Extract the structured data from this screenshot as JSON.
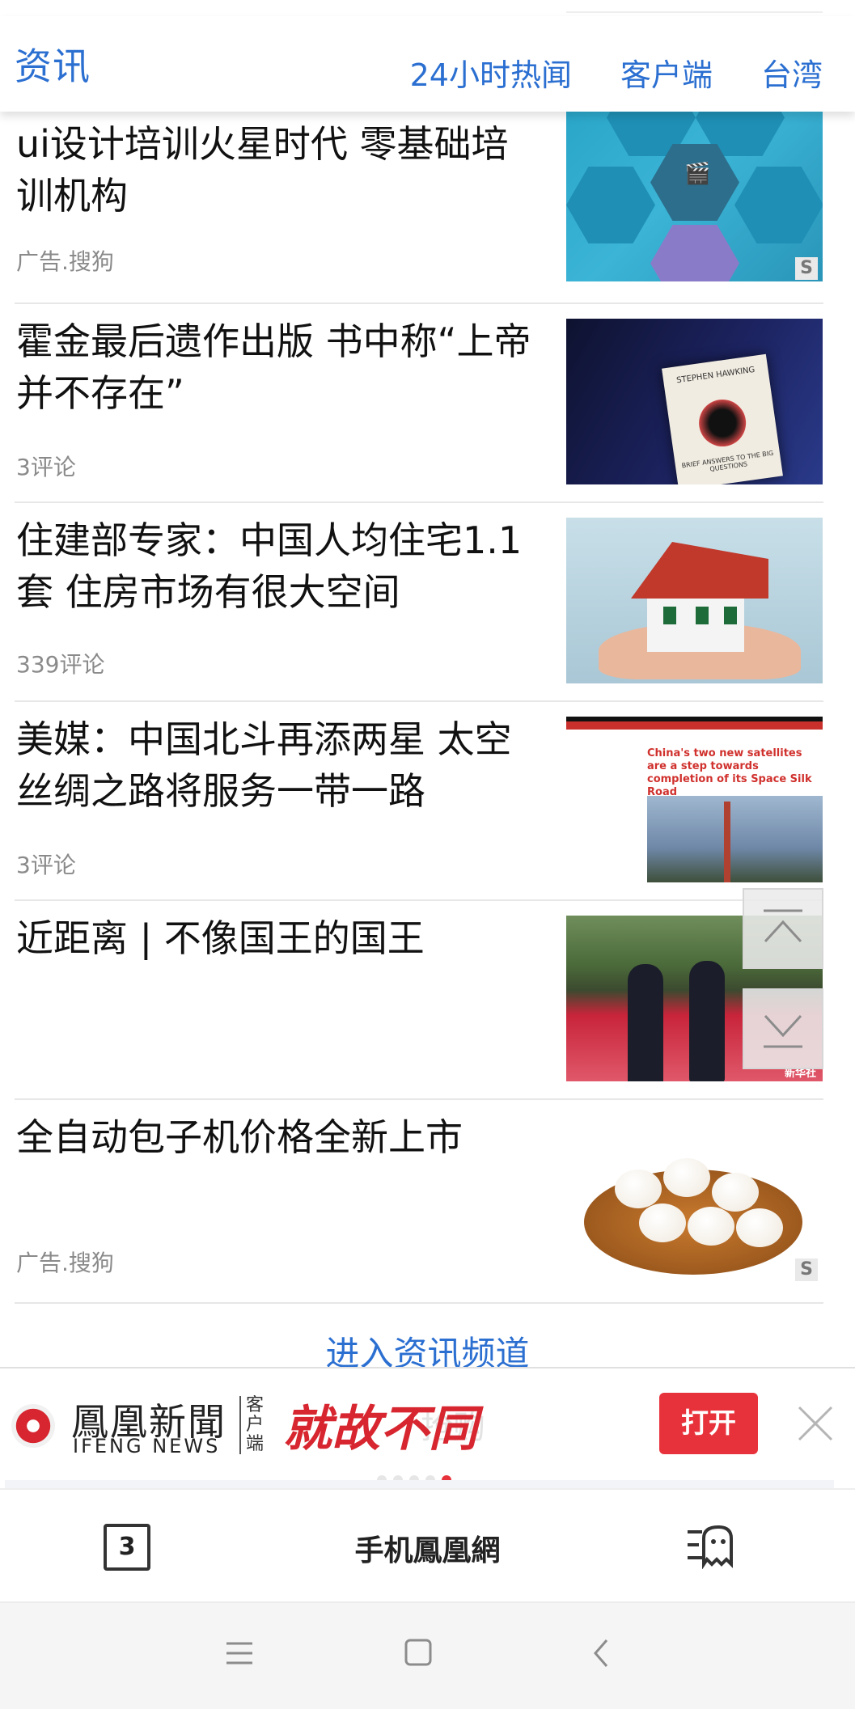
{
  "header": {
    "brand": "资讯",
    "nav": [
      "24小时热闻",
      "客户端",
      "台湾"
    ]
  },
  "feed": [
    {
      "title": "ui设计培训火星时代 零基础培训机构",
      "meta": "广告.搜狗",
      "thumb_icon": "media-app-hexagon-thumbnail",
      "source_badge": "S"
    },
    {
      "title": "霍金最后遗作出版 书中称“上帝并不存在”",
      "meta": "3评论",
      "thumb_icon": "hawking-book-thumbnail",
      "book_title": "STEPHEN HAWKING",
      "book_subtitle": "BRIEF ANSWERS TO THE BIG QUESTIONS"
    },
    {
      "title": "住建部专家：中国人均住宅1.1套 住房市场有很大空间",
      "meta": "339评论",
      "thumb_icon": "house-in-hands-thumbnail"
    },
    {
      "title": "美媒：中国北斗再添两星 太空丝绸之路将服务一带一路",
      "meta": "3评论",
      "thumb_icon": "rocket-launch-thumbnail",
      "headline_in_image": "China's two new satellites are a step towards completion of its Space Silk Road"
    },
    {
      "title": "近距离 | 不像国王的国王",
      "meta": "",
      "thumb_icon": "honor-guard-thumbnail",
      "image_credit": "新华社"
    },
    {
      "title": "全自动包子机价格全新上市",
      "meta": "广告.搜狗",
      "thumb_icon": "steamed-buns-thumbnail",
      "source_badge": "S"
    }
  ],
  "more_link": "进入资讯频道",
  "app_banner": {
    "logo_cn": "鳳凰新聞",
    "logo_en": "IFENG NEWS",
    "client_label": "客户端",
    "slogan": "就故不同",
    "open_label": "打开",
    "ghost_text": "抢购",
    "carousel_dots": 5,
    "active_dot": 4
  },
  "browser_bar": {
    "tab_count": "3",
    "site_title": "手机鳳凰網"
  },
  "colors": {
    "accent": "#2b6fd1",
    "brand_red": "#e8323b",
    "meta_gray": "#8a8a8a"
  }
}
